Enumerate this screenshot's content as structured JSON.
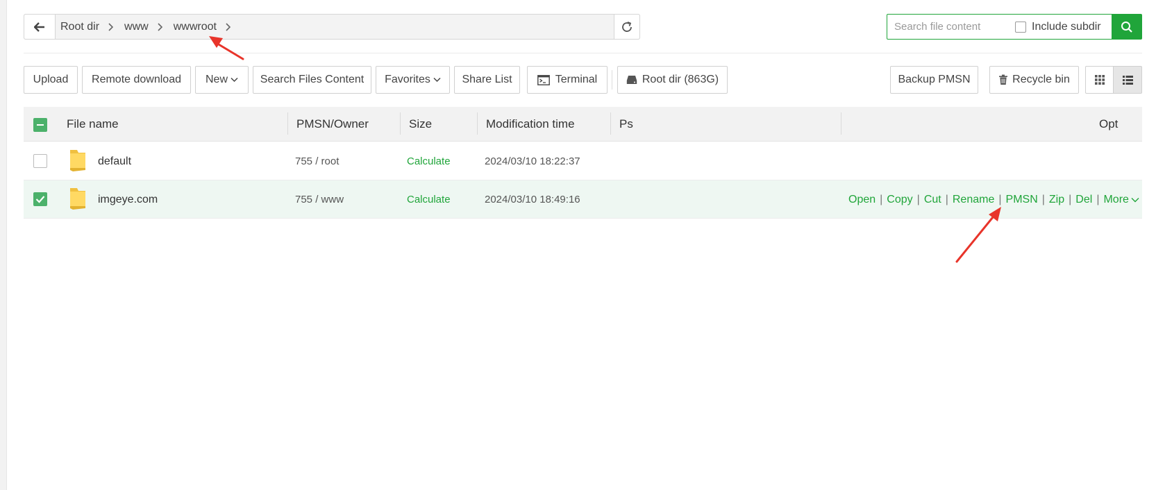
{
  "nav": {
    "breadcrumbs": [
      "Root dir",
      "www",
      "wwwroot"
    ]
  },
  "search": {
    "placeholder": "Search file content",
    "include_subdir_label": "Include subdir",
    "include_subdir_checked": false
  },
  "toolbar": {
    "upload": "Upload",
    "remote_download": "Remote download",
    "new": "New",
    "search_files_content": "Search Files Content",
    "favorites": "Favorites",
    "share_list": "Share List",
    "terminal": "Terminal",
    "root_dir": "Root dir (863G)",
    "backup_pmsn": "Backup PMSN",
    "recycle_bin": "Recycle bin"
  },
  "table": {
    "headers": {
      "name": "File name",
      "perm": "PMSN/Owner",
      "size": "Size",
      "mtime": "Modification time",
      "ps": "Ps",
      "opt": "Opt"
    },
    "rows": [
      {
        "name": "default",
        "perm": "755 / root",
        "size": "Calculate",
        "mtime": "2024/03/10 18:22:37",
        "selected": false
      },
      {
        "name": "imgeye.com",
        "perm": "755 / www",
        "size": "Calculate",
        "mtime": "2024/03/10 18:49:16",
        "selected": true
      }
    ],
    "row_actions": [
      "Open",
      "Copy",
      "Cut",
      "Rename",
      "PMSN",
      "Zip",
      "Del",
      "More"
    ]
  },
  "colors": {
    "accent": "#20a53a",
    "checkbox": "#4cb16b",
    "annotation_arrow": "#e8342a",
    "selected_row_bg": "#eef7f2"
  },
  "icons": [
    "arrow-left-icon",
    "chevron-right-icon",
    "refresh-icon",
    "search-icon",
    "chevron-down-icon",
    "terminal-icon",
    "disk-icon",
    "trash-icon",
    "grid-view-icon",
    "list-view-icon",
    "folder-icon",
    "checkmark-icon"
  ]
}
